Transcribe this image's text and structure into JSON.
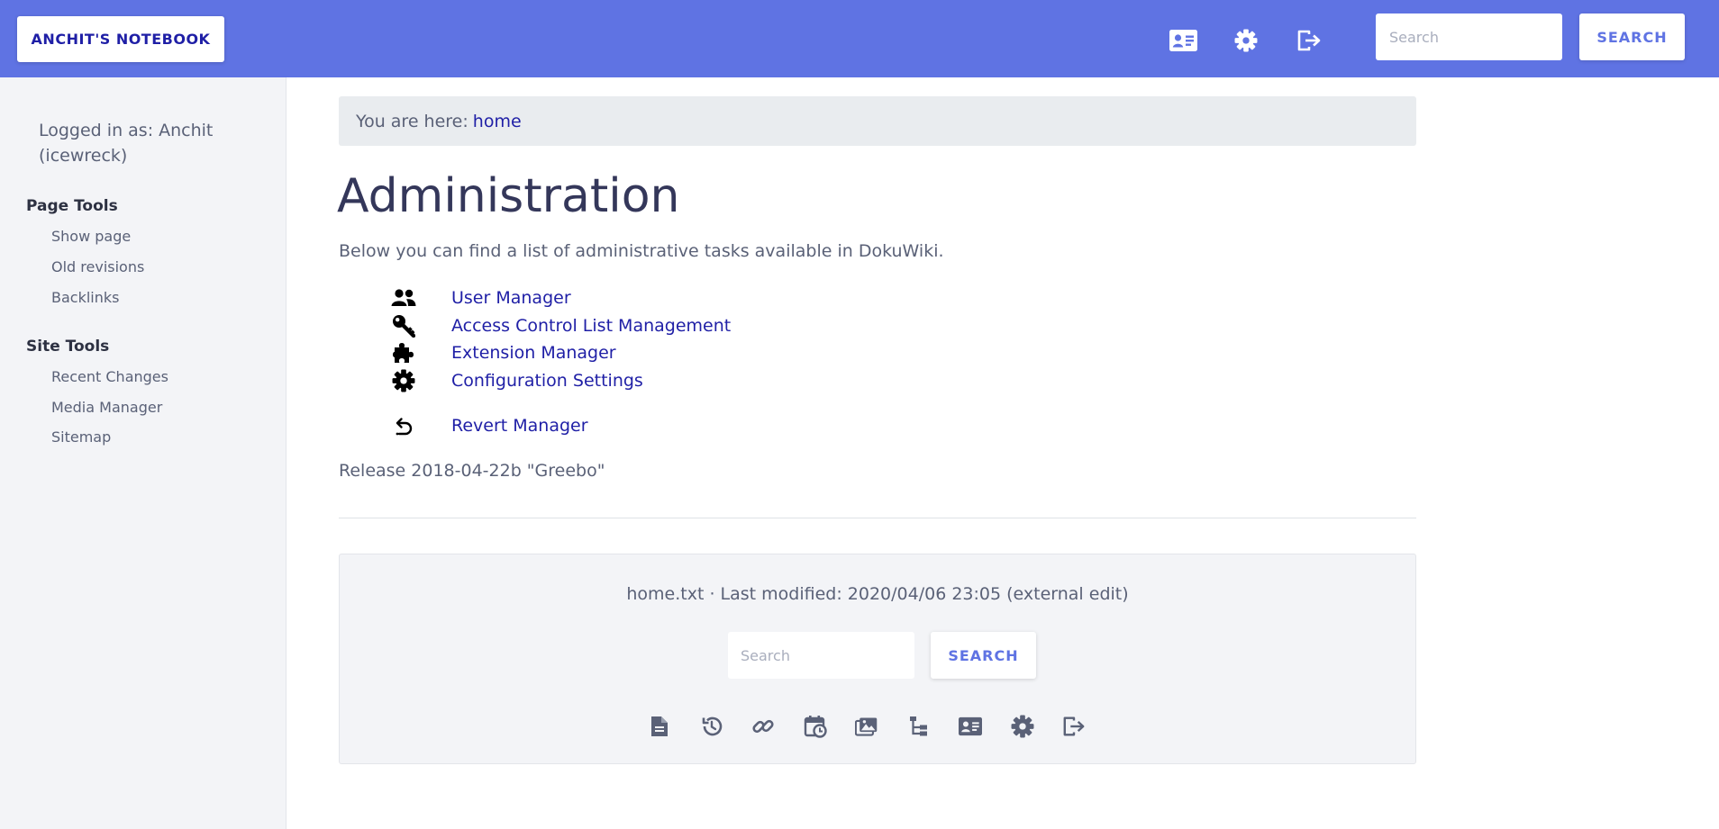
{
  "header": {
    "brand": "ANCHIT'S NOTEBOOK",
    "icons": [
      "profile-card-icon",
      "gear-icon",
      "logout-icon"
    ],
    "search_placeholder": "Search",
    "search_button": "SEARCH"
  },
  "colors": {
    "header_bg": "#5f73e3",
    "link": "#1f1fa6",
    "sidebar_bg": "#f3f4f7",
    "title": "#34375a",
    "icon_footer": "#5a6177"
  },
  "sidebar": {
    "logged_in": "Logged in as: Anchit (icewreck)",
    "page_tools": {
      "title": "Page Tools",
      "items": [
        "Show page",
        "Old revisions",
        "Backlinks"
      ]
    },
    "site_tools": {
      "title": "Site Tools",
      "items": [
        "Recent Changes",
        "Media Manager",
        "Sitemap"
      ]
    }
  },
  "breadcrumb": {
    "prefix": "You are here:",
    "link": "home"
  },
  "page": {
    "title": "Administration",
    "intro": "Below you can find a list of administrative tasks available in DokuWiki.",
    "admin_items": [
      {
        "label": "User Manager",
        "icon": "users-icon"
      },
      {
        "label": "Access Control List Management",
        "icon": "key-icon"
      },
      {
        "label": "Extension Manager",
        "icon": "puzzle-icon"
      },
      {
        "label": "Configuration Settings",
        "icon": "gear-icon"
      },
      {
        "label": "Revert Manager",
        "icon": "revert-icon"
      }
    ],
    "release": "Release 2018-04-22b \"Greebo\""
  },
  "footer": {
    "meta": "home.txt · Last modified: 2020/04/06 23:05 (external edit)",
    "search_placeholder": "Search",
    "search_button": "SEARCH",
    "icons": [
      "page-icon",
      "history-icon",
      "link-icon",
      "recent-changes-icon",
      "media-icon",
      "sitemap-icon",
      "profile-card-icon",
      "gear-icon",
      "logout-icon"
    ]
  }
}
